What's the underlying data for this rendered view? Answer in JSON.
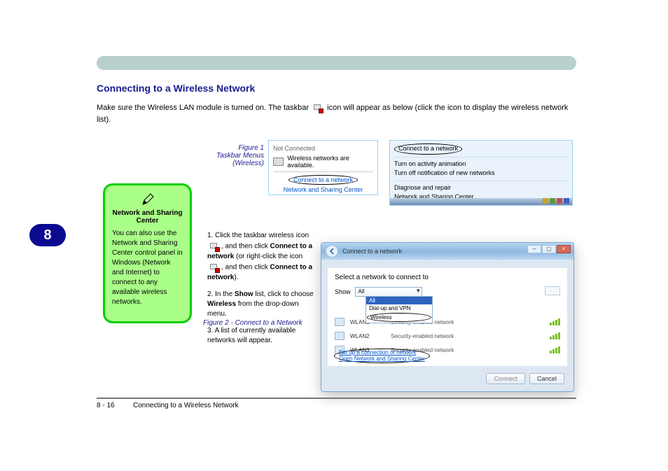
{
  "header_rule": true,
  "heading": "Connecting to a Wireless Network",
  "body_line1_prefix": "Make sure the Wireless LAN module is turned on. The taskbar ",
  "body_icon_line1": "network",
  "body_line1_suffix": " icon will appear as below (click the icon to display the wireless network list).",
  "tray_icon_semantic": "network-tray-icon",
  "note": {
    "title_line1": "Network and Sharing",
    "title_line2": "Center",
    "body": "You can also use the Network and Sharing Center control panel in Windows (Network and Internet) to connect to any available wireless networks."
  },
  "tab": "8",
  "fig1": {
    "caption": "Figure 1",
    "title1": "Taskbar Menus",
    "title2": "(Wireless)",
    "not_connected": "Not Connected",
    "available": "Wireless networks are available.",
    "connect": "Connect to a network",
    "nsc": "Network and Sharing Center"
  },
  "fig2": {
    "items": [
      "Connect to a network",
      "Turn on activity animation",
      "Turn off notification of new networks",
      "Diagnose and repair",
      "Network and Sharing Center"
    ]
  },
  "instr": {
    "lead": "1. Click the taskbar wireless icon",
    "cont": ", and then click ",
    "bold": "Connect to a network",
    "tail": " (or right-click the icon",
    "cont2": ", and then click ",
    "bold2": "Connect to a network",
    "tail2": ")."
  },
  "instr2": {
    "lead": "2. In the ",
    "b1": "Show",
    "mid": " list, click to choose ",
    "b2": "Wireless",
    "tail": " from the drop-down menu."
  },
  "instr3": "3. A list of currently available networks will appear.",
  "fig3": {
    "caption": "Figure 2",
    "title": "Connect to a Network",
    "win_title": "Connect to a network",
    "prompt": "Select a network to connect to",
    "show_label": "Show",
    "show_value": "All",
    "dd_all": "All",
    "dd_dialvpn": "Dial-up and VPN",
    "dd_wireless": "Wireless",
    "net_sec": "Security-enabled network",
    "net1": "WLAN1",
    "net2": "WLAN2",
    "net3": "WLAN3",
    "link1": "Set up a connection or network",
    "link2": "Open Network and Sharing Center",
    "btn_connect": "Connect",
    "btn_cancel": "Cancel"
  },
  "footer_left": "Connecting to a Wireless Network",
  "page_no": "8 - 16"
}
